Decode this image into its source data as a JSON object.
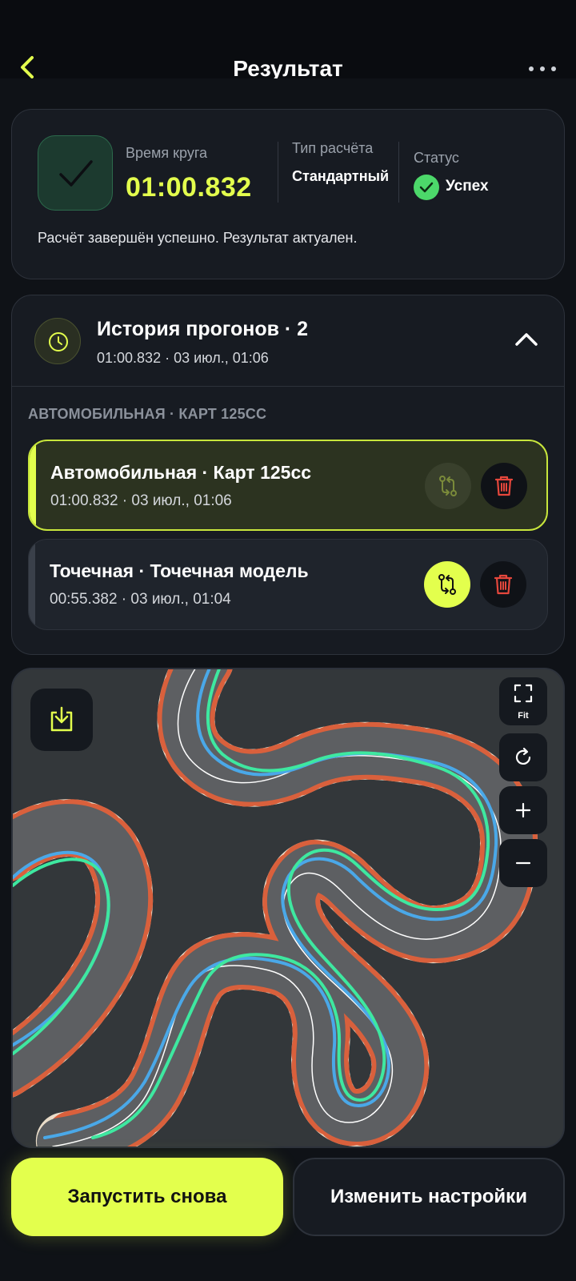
{
  "header": {
    "title": "Результат"
  },
  "result": {
    "lap_label": "Время круга",
    "lap_time": "01:00.832",
    "calc_label": "Тип расчёта",
    "calc_type": "Стандартный",
    "status_label": "Статус",
    "status_value": "Успех",
    "message": "Расчёт завершён успешно. Результат актуален."
  },
  "history": {
    "title": "История прогонов · 2",
    "subtitle": "01:00.832 · 03 июл., 01:06",
    "group_label": "АВТОМОБИЛЬНАЯ · КАРТ 125CC",
    "runs": [
      {
        "title": "Автомобильная · Карт 125cc",
        "subtitle": "01:00.832 · 03 июл., 01:06",
        "active": true
      },
      {
        "title": "Точечная · Точечная модель",
        "subtitle": "00:55.382 · 03 июл., 01:04",
        "active": false
      }
    ]
  },
  "map": {
    "fit_label": "Fit"
  },
  "actions": {
    "restart_label": "Запустить снова",
    "settings_label": "Изменить настройки"
  },
  "colors": {
    "accent": "#e3ff4d",
    "success": "#4cd86a",
    "danger": "#e5473c",
    "background": "#0f1217",
    "card": "#171b22",
    "line_primary": "#3ee8a0",
    "line_secondary": "#4aa8e8"
  }
}
